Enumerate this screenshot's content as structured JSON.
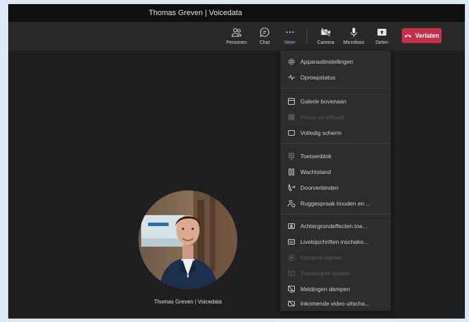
{
  "window": {
    "title": "Thomas Greven | Voicedata"
  },
  "toolbar": {
    "people": {
      "label": "Personen",
      "icon": "people-icon"
    },
    "chat": {
      "label": "Chat",
      "icon": "chat-icon"
    },
    "more": {
      "label": "Meer",
      "icon": "more-icon"
    },
    "camera": {
      "label": "Camera",
      "icon": "camera-off-icon"
    },
    "microphone": {
      "label": "Microfoon",
      "icon": "microphone-icon"
    },
    "share": {
      "label": "Delen",
      "icon": "share-icon"
    },
    "leave": {
      "label": "Verlaten",
      "icon": "phone-hangup-icon"
    },
    "active_color": "#9ea2ff",
    "leave_color": "#c4314b"
  },
  "participant": {
    "name": "Thomas Greven | Voicedata"
  },
  "menu": {
    "device_settings": "Apparaatinstellingen",
    "call_health": "Oproepstatus",
    "gallery_top": "Galerie bovenaan",
    "focus_content": "Focus op inhoud",
    "fullscreen": "Volledig scherm",
    "dialpad": "Toetsenblok",
    "hold": "Wachtstand",
    "transfer": "Doorverbinden",
    "consult": "Ruggespraak houden en ...",
    "background": "Achtergrondeffecten toe...",
    "captions": "Livebijschriften inschake...",
    "recording": "Opname starten",
    "transcription": "Transcriptie starten",
    "mute_notifications": "Meldingen dempen",
    "incoming_video": "Inkomende video uitscha..."
  }
}
